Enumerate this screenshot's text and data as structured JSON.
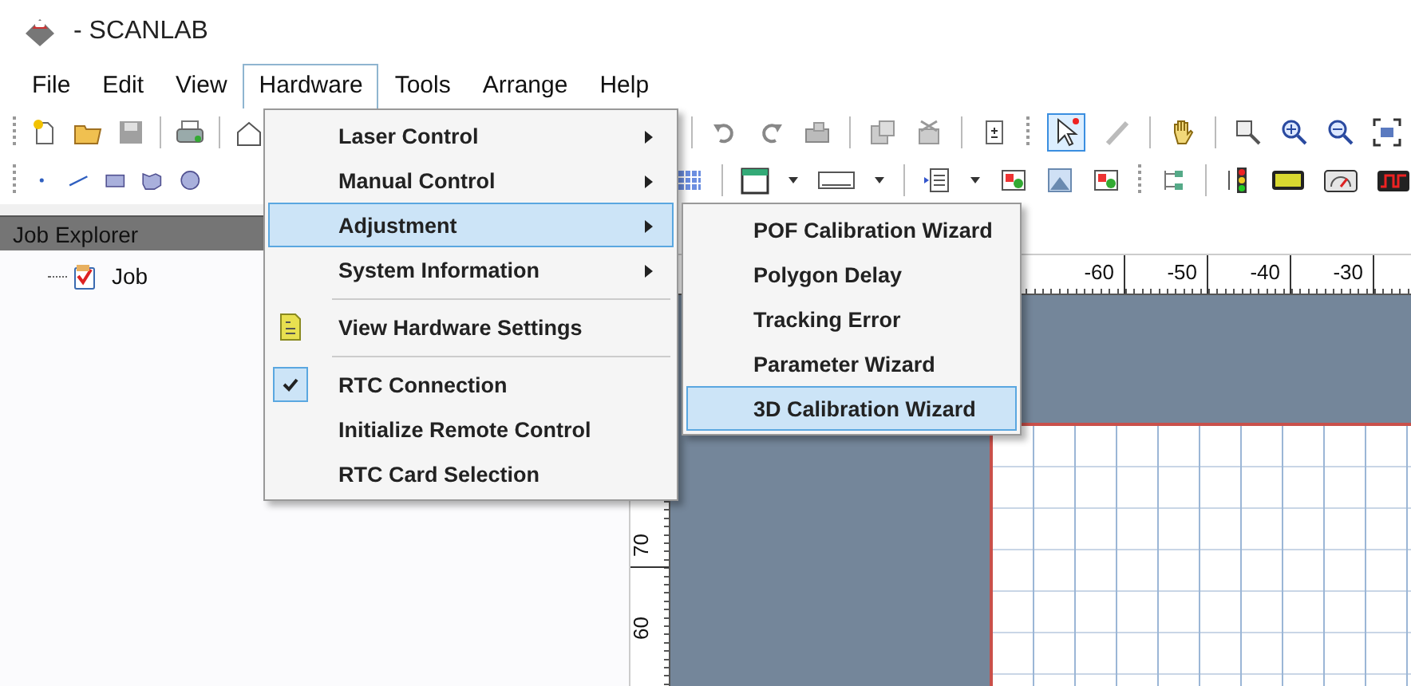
{
  "window": {
    "title": "- SCANLAB"
  },
  "menu_bar": [
    {
      "label": "File",
      "selected": false
    },
    {
      "label": "Edit",
      "selected": false
    },
    {
      "label": "View",
      "selected": false
    },
    {
      "label": "Hardware",
      "selected": true
    },
    {
      "label": "Tools",
      "selected": false
    },
    {
      "label": "Arrange",
      "selected": false
    },
    {
      "label": "Help",
      "selected": false
    }
  ],
  "toolbar": {
    "select_tool_active": true
  },
  "job_explorer": {
    "title": "Job Explorer",
    "tree": [
      {
        "label": "Job"
      }
    ]
  },
  "ruler_horizontal": [
    "-60",
    "-50",
    "-40",
    "-30"
  ],
  "ruler_vertical": [
    "70",
    "60"
  ],
  "hardware_menu": [
    {
      "kind": "submenu",
      "label": "Laser Control",
      "selected": false
    },
    {
      "kind": "submenu",
      "label": "Manual Control",
      "selected": false
    },
    {
      "kind": "submenu",
      "label": "Adjustment",
      "selected": true
    },
    {
      "kind": "submenu",
      "label": "System Information",
      "selected": false
    },
    {
      "kind": "separator"
    },
    {
      "kind": "icon",
      "label": "View Hardware Settings",
      "selected": false
    },
    {
      "kind": "separator"
    },
    {
      "kind": "check",
      "label": "RTC Connection",
      "checked": true,
      "selected": false
    },
    {
      "kind": "plain",
      "label": "Initialize Remote Control",
      "selected": false
    },
    {
      "kind": "plain",
      "label": "RTC Card Selection",
      "selected": false
    }
  ],
  "adjustment_submenu": [
    {
      "label": "POF Calibration Wizard",
      "selected": false
    },
    {
      "label": "Polygon Delay",
      "selected": false
    },
    {
      "label": "Tracking Error",
      "selected": false
    },
    {
      "label": "Parameter Wizard",
      "selected": false
    },
    {
      "label": "3D Calibration Wizard",
      "selected": true
    }
  ]
}
